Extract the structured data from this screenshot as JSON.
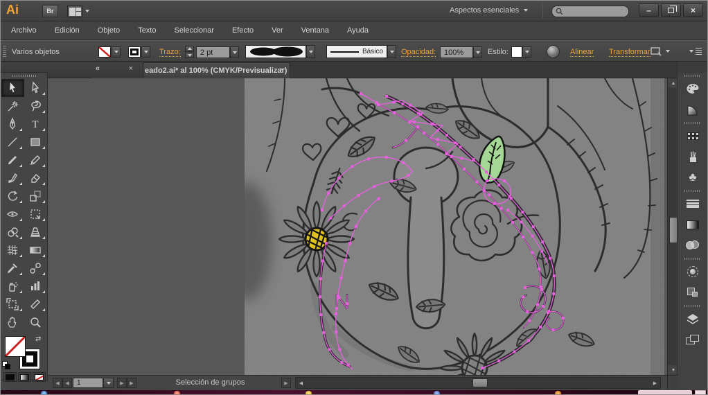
{
  "titlebar": {
    "logo": "Ai",
    "bridge_label": "Br",
    "workspace_label": "Aspectos esenciales",
    "search_placeholder": ""
  },
  "menubar": {
    "items": [
      "Archivo",
      "Edición",
      "Objeto",
      "Texto",
      "Seleccionar",
      "Efecto",
      "Ver",
      "Ventana",
      "Ayuda"
    ]
  },
  "controlbar": {
    "selection_info": "Varios objetos",
    "stroke_link": "Trazo:",
    "stroke_width_value": "2 pt",
    "brush_name": "Básico",
    "opacity_link": "Opacidad:",
    "opacity_value": "100%",
    "style_label": "Estilo:",
    "align_link": "Alinear",
    "transform_link": "Transformar"
  },
  "tabbar": {
    "document_title": "eado2.ai* al 100% (CMYK/Previsualizar)"
  },
  "tools": {
    "type_glyph": "T"
  },
  "statusbar": {
    "nav_value": "1",
    "status_text": "Selección de grupos"
  },
  "icons": {
    "minimize": "–",
    "close": "×",
    "collapse": "«",
    "up": "▲",
    "down": "▼",
    "left": "◀",
    "right": "▶",
    "club": "♣",
    "swap": "⇄"
  },
  "colors": {
    "accent_orange": "#E8A23C",
    "selection_pink": "#E85FE0",
    "leaf_green": "#A5D795",
    "flower_yellow": "#DFC11F"
  }
}
